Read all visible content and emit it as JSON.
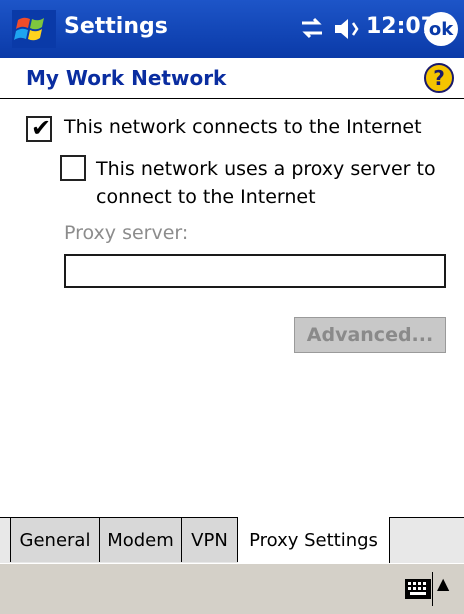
{
  "titlebar": {
    "title": "Settings",
    "time": "12:07",
    "ok_label": "ok",
    "icons": [
      "windows-start-icon",
      "connectivity-icon",
      "volume-icon"
    ]
  },
  "header": {
    "title": "My Work Network",
    "help_label": "?"
  },
  "options": {
    "internet_label": "This network connects to the Internet",
    "internet_checked": true,
    "proxy_label": "This network uses a proxy server to connect to the Internet",
    "proxy_checked": false
  },
  "proxy": {
    "label": "Proxy server:",
    "value": ""
  },
  "advanced_label": "Advanced...",
  "tabs": [
    {
      "label": "General",
      "active": false
    },
    {
      "label": "Modem",
      "active": false
    },
    {
      "label": "VPN",
      "active": false
    },
    {
      "label": "Proxy Settings",
      "active": true
    }
  ],
  "bottombar": {
    "icons": [
      "keyboard-icon",
      "up-arrow-icon"
    ]
  }
}
